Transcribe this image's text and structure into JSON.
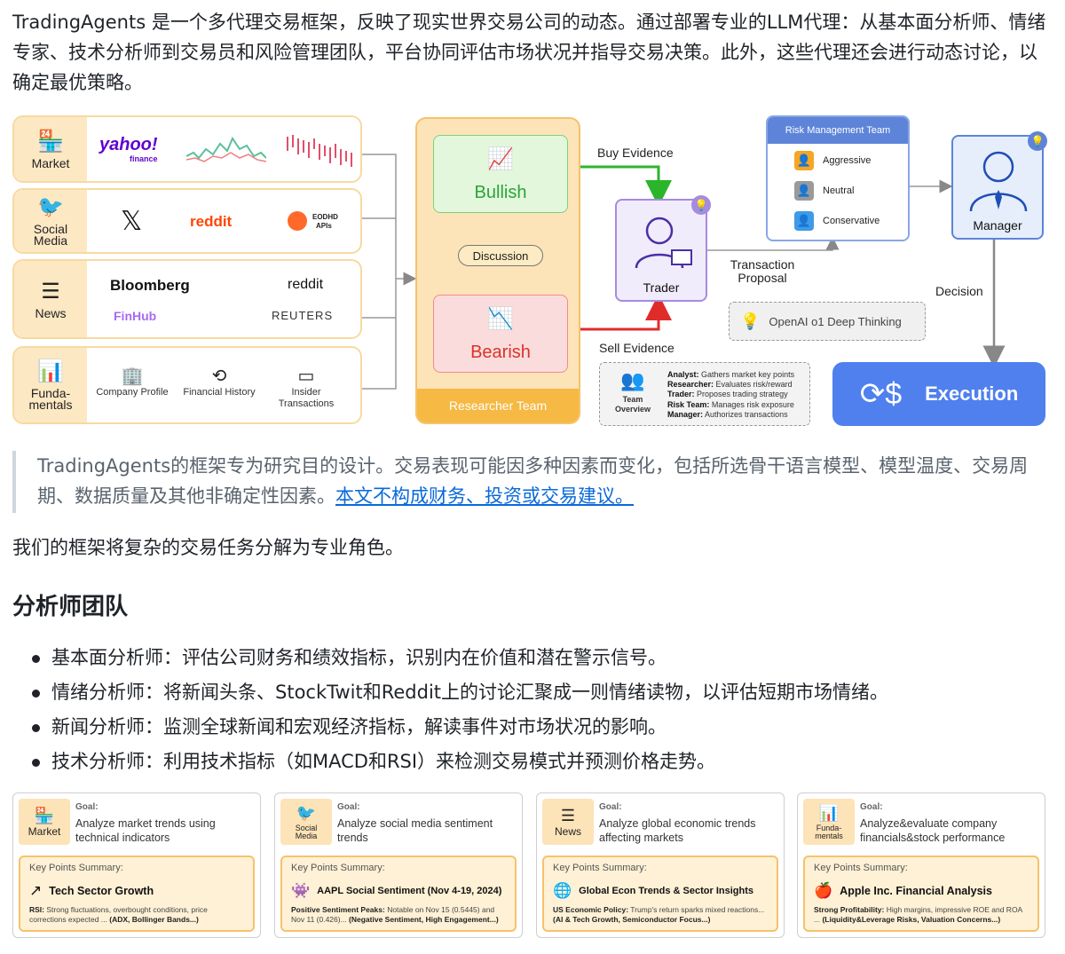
{
  "intro": "TradingAgents 是一个多代理交易框架，反映了现实世界交易公司的动态。通过部署专业的LLM代理：从基本面分析师、情绪专家、技术分析师到交易员和风险管理团队，平台协同评估市场状况并指导交易决策。此外，这些代理还会进行动态讨论，以确定最优策略。",
  "diagram": {
    "sources": [
      {
        "label": "Market",
        "icon": "store-icon",
        "logos": [
          "yahoo!",
          "finance"
        ]
      },
      {
        "label": "Social Media",
        "icon": "bird-icon",
        "logos": [
          "𝕏",
          "reddit",
          "EODHD",
          "APIs"
        ]
      },
      {
        "label": "News",
        "icon": "news-icon",
        "logos": [
          "Bloomberg",
          "reddit",
          "FinHub",
          "REUTERS"
        ]
      },
      {
        "label": "Funda-mentals",
        "icon": "bar-chart-icon",
        "subitems": [
          "Company Profile",
          "Financial History",
          "Insider Transactions"
        ]
      }
    ],
    "researcher_team": "Researcher Team",
    "bullish": "Bullish",
    "bearish": "Bearish",
    "discussion": "Discussion",
    "buy_evidence": "Buy Evidence",
    "sell_evidence": "Sell Evidence",
    "trader": "Trader",
    "transaction_proposal": "Transaction Proposal",
    "risk_team": {
      "title": "Risk Management Team",
      "members": [
        "Aggressive",
        "Neutral",
        "Conservative"
      ]
    },
    "manager": "Manager",
    "decision": "Decision",
    "execution": "Execution",
    "openai": "OpenAI o1 Deep Thinking",
    "team_overview": {
      "label": "Team Overview",
      "lines": [
        {
          "role": "Analyst:",
          "desc": "Gathers market key points"
        },
        {
          "role": "Researcher:",
          "desc": "Evaluates risk/reward"
        },
        {
          "role": "Trader:",
          "desc": "Proposes trading strategy"
        },
        {
          "role": "Risk Team:",
          "desc": "Manages risk exposure"
        },
        {
          "role": "Manager:",
          "desc": "Authorizes transactions"
        }
      ]
    },
    "colors": {
      "bullish": "#2ba33b",
      "bearish": "#d8342b",
      "execution": "#4f80ee",
      "researcher": "#f5b944",
      "trader_border": "#a58be0"
    }
  },
  "quote": {
    "text": "TradingAgents的框架专为研究目的设计。交易表现可能因多种因素而变化，包括所选骨干语言模型、模型温度、交易周期、数据质量及其他非确定性因素。",
    "link": "本文不构成财务、投资或交易建议。"
  },
  "para2": "我们的框架将复杂的交易任务分解为专业角色。",
  "heading": "分析师团队",
  "bullets": [
    "基本面分析师：评估公司财务和绩效指标，识别内在价值和潜在警示信号。",
    "情绪分析师：将新闻头条、StockTwit和Reddit上的讨论汇聚成一则情绪读物，以评估短期市场情绪。",
    "新闻分析师：监测全球新闻和宏观经济指标，解读事件对市场状况的影响。",
    "技术分析师：利用技术指标（如MACD和RSI）来检测交易模式并预测价格走势。"
  ],
  "cards": [
    {
      "tab": "Market",
      "icon": "store-icon",
      "goal_label": "Goal:",
      "goal": "Analyze market trends using technical indicators",
      "kp_label": "Key Points Summary:",
      "kp_icon": "trend-up-icon",
      "kp_title": "Tech Sector Growth",
      "kp_bold": "RSI:",
      "kp_text": " Strong fluctuations, overbought conditions, price corrections expected ... ",
      "kp_bold2": "(ADX, Bollinger Bands...)"
    },
    {
      "tab": "Social Media",
      "icon": "bird-icon",
      "goal_label": "Goal:",
      "goal": "Analyze social media sentiment trends",
      "kp_label": "Key Points Summary:",
      "kp_icon": "reddit-icon",
      "kp_title": "AAPL Social Sentiment (Nov 4-19, 2024)",
      "kp_bold": "Positive Sentiment Peaks:",
      "kp_text": " Notable on Nov 15 (0.5445) and Nov 11 (0.426)... ",
      "kp_bold2": "(Negative Sentiment,  High Engagement...)"
    },
    {
      "tab": "News",
      "icon": "news-icon",
      "goal_label": "Goal:",
      "goal": "Analyze global economic trends affecting markets",
      "kp_label": "Key Points Summary:",
      "kp_icon": "globe-icon",
      "kp_title": "Global Econ Trends & Sector Insights",
      "kp_bold": "US Economic Policy:",
      "kp_text": " Trump's return sparks mixed reactions...",
      "kp_bold2": "(AI & Tech Growth, Semiconductor Focus...)"
    },
    {
      "tab": "Funda-mentals",
      "icon": "bar-chart-icon",
      "goal_label": "Goal:",
      "goal": "Analyze&evaluate company financials&stock performance",
      "kp_label": "Key Points Summary:",
      "kp_icon": "apple-icon",
      "kp_title": "Apple Inc. Financial Analysis",
      "kp_bold": "Strong Profitability:",
      "kp_text": " High margins, impressive ROE and ROA ... ",
      "kp_bold2": "(Liquidity&Leverage Risks, Valuation Concerns...)"
    }
  ]
}
